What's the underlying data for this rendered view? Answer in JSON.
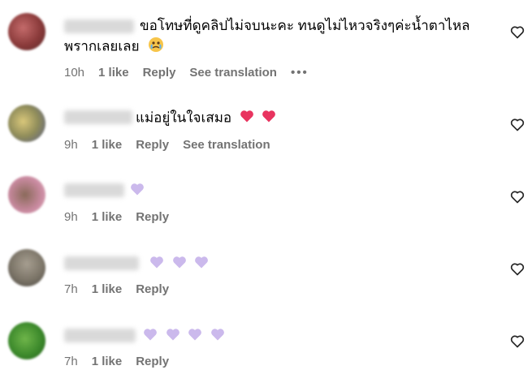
{
  "comments": [
    {
      "username": "kk_yaowaa",
      "text": "ขอโทษที่ดูคลิปไม่จบนะคะ ทนดูไม่ไหวจริงๆค่ะน้ำตาไหล",
      "text2": "พรากเลยเลย",
      "emoji_icon": "crying-face-icon",
      "time": "10h",
      "likes": "1 like",
      "reply": "Reply",
      "translate": "See translation",
      "more": "•••",
      "avatar_color": "#8a3a3a"
    },
    {
      "username": "phooci_ud",
      "text": "แม่อยู่ในใจเสมอ",
      "emoji_icon": "pink-heart-icon",
      "time": "9h",
      "likes": "1 like",
      "reply": "Reply",
      "translate": "See translation",
      "avatar_color": "#b9a24a"
    },
    {
      "username": "juniatyth",
      "emoji_icon": "lavender-heart-icon",
      "time": "9h",
      "likes": "1 like",
      "reply": "Reply",
      "avatar_color": "#d69ab0"
    },
    {
      "username": "phoymmm",
      "emoji_icon": "lavender-heart-icon",
      "time": "7h",
      "likes": "1 like",
      "reply": "Reply",
      "avatar_color": "#7c7568"
    },
    {
      "username": "thanidartte",
      "emoji_icon": "lavender-heart-icon",
      "time": "7h",
      "likes": "1 like",
      "reply": "Reply",
      "avatar_color": "#3d8a2c"
    }
  ],
  "colors": {
    "meta_text": "#737373",
    "pink_heart": "#e8345f",
    "lavender_heart": "#cbb9ec"
  }
}
